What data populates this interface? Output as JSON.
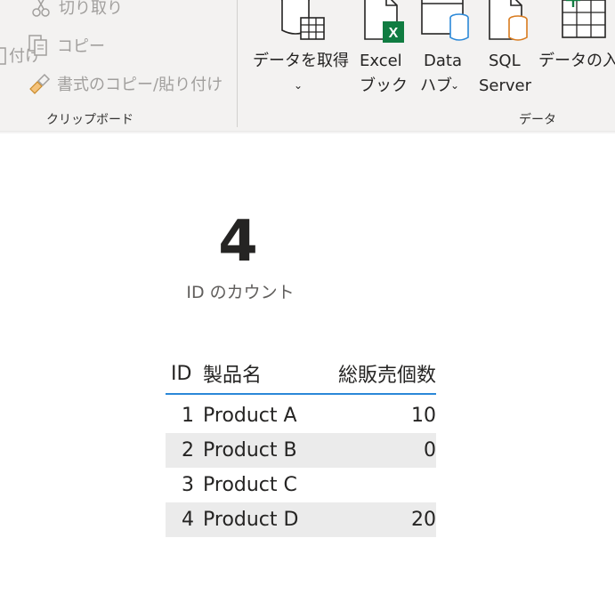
{
  "ribbon": {
    "clipboard": {
      "label": "クリップボード",
      "paste_partial": "付け",
      "cut": "切り取り",
      "copy": "コピー",
      "format_painter": "書式のコピー/貼り付け"
    },
    "data": {
      "label": "データ",
      "get_data": "データを取得",
      "excel_line1": "Excel",
      "excel_line2": "ブック",
      "hub_line1": "Data",
      "hub_line2": "ハブ",
      "sql_line1": "SQL",
      "sql_line2": "Server",
      "enter_data": "データの入"
    },
    "colors": {
      "excel_green": "#107c41",
      "accent_blue": "#2b88d8",
      "sql_orange": "#d97b1e"
    }
  },
  "card": {
    "value": "4",
    "label": "ID のカウント"
  },
  "table": {
    "headers": {
      "id": "ID",
      "name": "製品名",
      "qty": "総販売個数"
    },
    "rows": [
      {
        "id": "1",
        "name": "Product A",
        "qty": "10"
      },
      {
        "id": "2",
        "name": "Product B",
        "qty": "0"
      },
      {
        "id": "3",
        "name": "Product C",
        "qty": ""
      },
      {
        "id": "4",
        "name": "Product D",
        "qty": "20"
      }
    ]
  }
}
